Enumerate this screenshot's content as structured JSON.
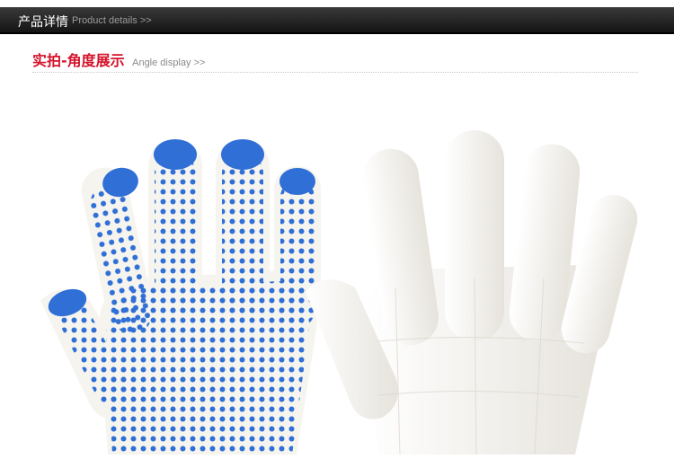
{
  "header": {
    "title_zh": "产品详情",
    "title_en": "Product details >>"
  },
  "section": {
    "title_zh": "实拍-角度展示",
    "title_en": "Angle display >>"
  },
  "colors": {
    "header_bg": "#1a1a1a",
    "accent_red": "#d4122a",
    "dot_blue": "#2f6fd6",
    "glove_white": "#f3f1ec"
  },
  "photo": {
    "subject": "gloves-image"
  }
}
